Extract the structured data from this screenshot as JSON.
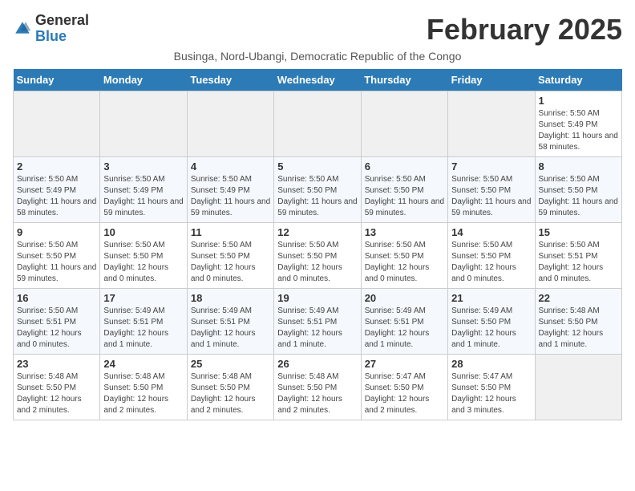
{
  "logo": {
    "general": "General",
    "blue": "Blue"
  },
  "title": "February 2025",
  "subtitle": "Businga, Nord-Ubangi, Democratic Republic of the Congo",
  "days_of_week": [
    "Sunday",
    "Monday",
    "Tuesday",
    "Wednesday",
    "Thursday",
    "Friday",
    "Saturday"
  ],
  "weeks": [
    [
      {
        "num": "",
        "info": ""
      },
      {
        "num": "",
        "info": ""
      },
      {
        "num": "",
        "info": ""
      },
      {
        "num": "",
        "info": ""
      },
      {
        "num": "",
        "info": ""
      },
      {
        "num": "",
        "info": ""
      },
      {
        "num": "1",
        "info": "Sunrise: 5:50 AM\nSunset: 5:49 PM\nDaylight: 11 hours\nand 58 minutes."
      }
    ],
    [
      {
        "num": "2",
        "info": "Sunrise: 5:50 AM\nSunset: 5:49 PM\nDaylight: 11 hours\nand 58 minutes."
      },
      {
        "num": "3",
        "info": "Sunrise: 5:50 AM\nSunset: 5:49 PM\nDaylight: 11 hours\nand 59 minutes."
      },
      {
        "num": "4",
        "info": "Sunrise: 5:50 AM\nSunset: 5:49 PM\nDaylight: 11 hours\nand 59 minutes."
      },
      {
        "num": "5",
        "info": "Sunrise: 5:50 AM\nSunset: 5:50 PM\nDaylight: 11 hours\nand 59 minutes."
      },
      {
        "num": "6",
        "info": "Sunrise: 5:50 AM\nSunset: 5:50 PM\nDaylight: 11 hours\nand 59 minutes."
      },
      {
        "num": "7",
        "info": "Sunrise: 5:50 AM\nSunset: 5:50 PM\nDaylight: 11 hours\nand 59 minutes."
      },
      {
        "num": "8",
        "info": "Sunrise: 5:50 AM\nSunset: 5:50 PM\nDaylight: 11 hours\nand 59 minutes."
      }
    ],
    [
      {
        "num": "9",
        "info": "Sunrise: 5:50 AM\nSunset: 5:50 PM\nDaylight: 11 hours\nand 59 minutes."
      },
      {
        "num": "10",
        "info": "Sunrise: 5:50 AM\nSunset: 5:50 PM\nDaylight: 12 hours\nand 0 minutes."
      },
      {
        "num": "11",
        "info": "Sunrise: 5:50 AM\nSunset: 5:50 PM\nDaylight: 12 hours\nand 0 minutes."
      },
      {
        "num": "12",
        "info": "Sunrise: 5:50 AM\nSunset: 5:50 PM\nDaylight: 12 hours\nand 0 minutes."
      },
      {
        "num": "13",
        "info": "Sunrise: 5:50 AM\nSunset: 5:50 PM\nDaylight: 12 hours\nand 0 minutes."
      },
      {
        "num": "14",
        "info": "Sunrise: 5:50 AM\nSunset: 5:50 PM\nDaylight: 12 hours\nand 0 minutes."
      },
      {
        "num": "15",
        "info": "Sunrise: 5:50 AM\nSunset: 5:51 PM\nDaylight: 12 hours\nand 0 minutes."
      }
    ],
    [
      {
        "num": "16",
        "info": "Sunrise: 5:50 AM\nSunset: 5:51 PM\nDaylight: 12 hours\nand 0 minutes."
      },
      {
        "num": "17",
        "info": "Sunrise: 5:49 AM\nSunset: 5:51 PM\nDaylight: 12 hours\nand 1 minute."
      },
      {
        "num": "18",
        "info": "Sunrise: 5:49 AM\nSunset: 5:51 PM\nDaylight: 12 hours\nand 1 minute."
      },
      {
        "num": "19",
        "info": "Sunrise: 5:49 AM\nSunset: 5:51 PM\nDaylight: 12 hours\nand 1 minute."
      },
      {
        "num": "20",
        "info": "Sunrise: 5:49 AM\nSunset: 5:51 PM\nDaylight: 12 hours\nand 1 minute."
      },
      {
        "num": "21",
        "info": "Sunrise: 5:49 AM\nSunset: 5:50 PM\nDaylight: 12 hours\nand 1 minute."
      },
      {
        "num": "22",
        "info": "Sunrise: 5:48 AM\nSunset: 5:50 PM\nDaylight: 12 hours\nand 1 minute."
      }
    ],
    [
      {
        "num": "23",
        "info": "Sunrise: 5:48 AM\nSunset: 5:50 PM\nDaylight: 12 hours\nand 2 minutes."
      },
      {
        "num": "24",
        "info": "Sunrise: 5:48 AM\nSunset: 5:50 PM\nDaylight: 12 hours\nand 2 minutes."
      },
      {
        "num": "25",
        "info": "Sunrise: 5:48 AM\nSunset: 5:50 PM\nDaylight: 12 hours\nand 2 minutes."
      },
      {
        "num": "26",
        "info": "Sunrise: 5:48 AM\nSunset: 5:50 PM\nDaylight: 12 hours\nand 2 minutes."
      },
      {
        "num": "27",
        "info": "Sunrise: 5:47 AM\nSunset: 5:50 PM\nDaylight: 12 hours\nand 2 minutes."
      },
      {
        "num": "28",
        "info": "Sunrise: 5:47 AM\nSunset: 5:50 PM\nDaylight: 12 hours\nand 3 minutes."
      },
      {
        "num": "",
        "info": ""
      }
    ]
  ]
}
